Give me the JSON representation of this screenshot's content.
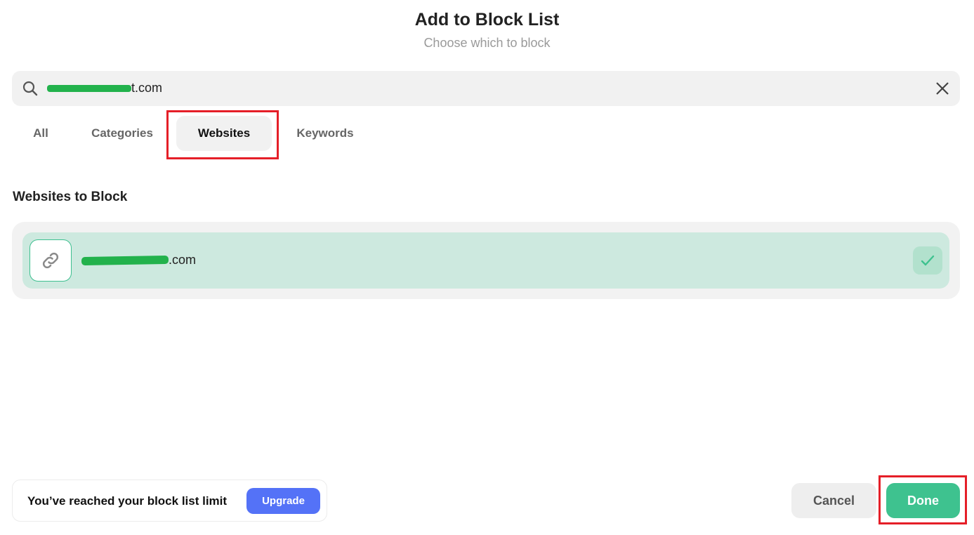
{
  "header": {
    "title": "Add to Block List",
    "subtitle": "Choose which to block"
  },
  "search": {
    "value_visible_suffix": "t.com",
    "value_redacted": true,
    "clear_icon": "close-icon",
    "search_icon": "search-icon"
  },
  "tabs": [
    {
      "label": "All",
      "active": false
    },
    {
      "label": "Categories",
      "active": false
    },
    {
      "label": "Websites",
      "active": true
    },
    {
      "label": "Keywords",
      "active": false
    }
  ],
  "section": {
    "title": "Websites to Block"
  },
  "websites": [
    {
      "visible_suffix": ".com",
      "redacted": true,
      "icon": "link-icon",
      "selected": true
    }
  ],
  "limit_banner": {
    "text": "You’ve reached your block list limit",
    "upgrade_label": "Upgrade"
  },
  "footer": {
    "cancel_label": "Cancel",
    "done_label": "Done"
  },
  "colors": {
    "accent_green": "#3ec28f",
    "selected_row": "#cde9df",
    "upgrade_blue": "#5472f7",
    "annotation_red": "#e51f28"
  }
}
